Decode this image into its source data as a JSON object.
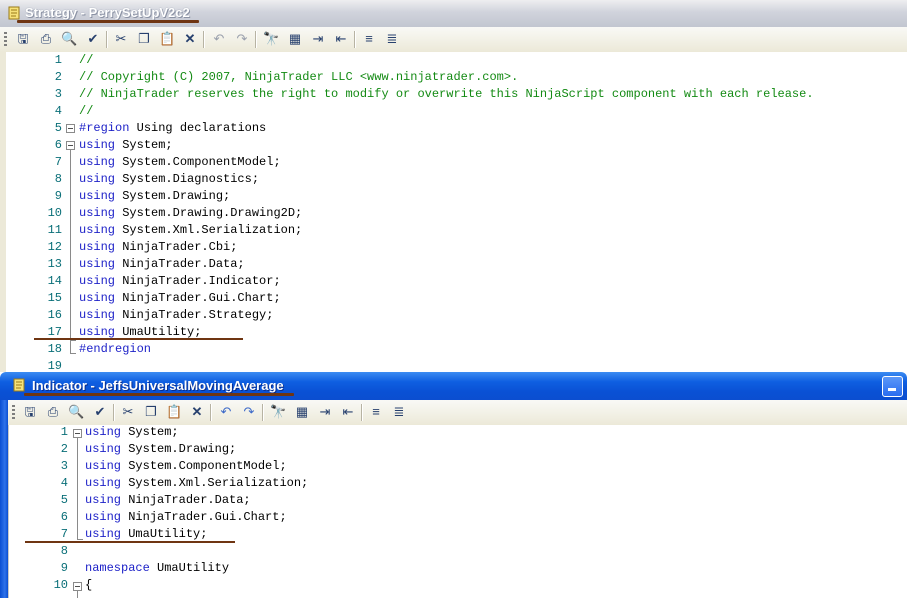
{
  "windows": {
    "strategy": {
      "title": "Strategy - PerrySetUpV2c2",
      "lines": [
        {
          "n": "1",
          "parts": [
            {
              "t": "//",
              "c": "cm"
            }
          ]
        },
        {
          "n": "2",
          "parts": [
            {
              "t": "// Copyright (C) 2007, NinjaTrader LLC <www.ninjatrader.com>.",
              "c": "cm"
            }
          ]
        },
        {
          "n": "3",
          "parts": [
            {
              "t": "// NinjaTrader reserves the right to modify or overwrite this NinjaScript component with each release.",
              "c": "cm"
            }
          ]
        },
        {
          "n": "4",
          "parts": [
            {
              "t": "//",
              "c": "cm"
            }
          ]
        },
        {
          "n": "5",
          "parts": [
            {
              "t": "#region",
              "c": "kw"
            },
            {
              "t": " Using declarations",
              "c": ""
            }
          ]
        },
        {
          "n": "6",
          "parts": [
            {
              "t": "using",
              "c": "kw"
            },
            {
              "t": " System;",
              "c": ""
            }
          ]
        },
        {
          "n": "7",
          "parts": [
            {
              "t": "using",
              "c": "kw"
            },
            {
              "t": " System.ComponentModel;",
              "c": ""
            }
          ]
        },
        {
          "n": "8",
          "parts": [
            {
              "t": "using",
              "c": "kw"
            },
            {
              "t": " System.Diagnostics;",
              "c": ""
            }
          ]
        },
        {
          "n": "9",
          "parts": [
            {
              "t": "using",
              "c": "kw"
            },
            {
              "t": " System.Drawing;",
              "c": ""
            }
          ]
        },
        {
          "n": "10",
          "parts": [
            {
              "t": "using",
              "c": "kw"
            },
            {
              "t": " System.Drawing.Drawing2D;",
              "c": ""
            }
          ]
        },
        {
          "n": "11",
          "parts": [
            {
              "t": "using",
              "c": "kw"
            },
            {
              "t": " System.Xml.Serialization;",
              "c": ""
            }
          ]
        },
        {
          "n": "12",
          "parts": [
            {
              "t": "using",
              "c": "kw"
            },
            {
              "t": " NinjaTrader.Cbi;",
              "c": ""
            }
          ]
        },
        {
          "n": "13",
          "parts": [
            {
              "t": "using",
              "c": "kw"
            },
            {
              "t": " NinjaTrader.Data;",
              "c": ""
            }
          ]
        },
        {
          "n": "14",
          "parts": [
            {
              "t": "using",
              "c": "kw"
            },
            {
              "t": " NinjaTrader.Indicator;",
              "c": ""
            }
          ]
        },
        {
          "n": "15",
          "parts": [
            {
              "t": "using",
              "c": "kw"
            },
            {
              "t": " NinjaTrader.Gui.Chart;",
              "c": ""
            }
          ]
        },
        {
          "n": "16",
          "parts": [
            {
              "t": "using",
              "c": "kw"
            },
            {
              "t": " NinjaTrader.Strategy;",
              "c": ""
            }
          ]
        },
        {
          "n": "17",
          "parts": [
            {
              "t": "using",
              "c": "kw"
            },
            {
              "t": " UmaUtility;",
              "c": ""
            }
          ]
        },
        {
          "n": "18",
          "parts": [
            {
              "t": "#endregion",
              "c": "kw"
            }
          ]
        },
        {
          "n": "19",
          "parts": []
        }
      ]
    },
    "indicator": {
      "title": "Indicator - JeffsUniversalMovingAverage",
      "lines": [
        {
          "n": "1",
          "parts": [
            {
              "t": "using",
              "c": "kw"
            },
            {
              "t": " System;",
              "c": ""
            }
          ]
        },
        {
          "n": "2",
          "parts": [
            {
              "t": "using",
              "c": "kw"
            },
            {
              "t": " System.Drawing;",
              "c": ""
            }
          ]
        },
        {
          "n": "3",
          "parts": [
            {
              "t": "using",
              "c": "kw"
            },
            {
              "t": " System.ComponentModel;",
              "c": ""
            }
          ]
        },
        {
          "n": "4",
          "parts": [
            {
              "t": "using",
              "c": "kw"
            },
            {
              "t": " System.Xml.Serialization;",
              "c": ""
            }
          ]
        },
        {
          "n": "5",
          "parts": [
            {
              "t": "using",
              "c": "kw"
            },
            {
              "t": " NinjaTrader.Data;",
              "c": ""
            }
          ]
        },
        {
          "n": "6",
          "parts": [
            {
              "t": "using",
              "c": "kw"
            },
            {
              "t": " NinjaTrader.Gui.Chart;",
              "c": ""
            }
          ]
        },
        {
          "n": "7",
          "parts": [
            {
              "t": "using",
              "c": "kw"
            },
            {
              "t": " UmaUtility;",
              "c": ""
            }
          ]
        },
        {
          "n": "8",
          "parts": []
        },
        {
          "n": "9",
          "parts": [
            {
              "t": "namespace",
              "c": "kw"
            },
            {
              "t": " UmaUtility",
              "c": ""
            }
          ]
        },
        {
          "n": "10",
          "parts": [
            {
              "t": "{",
              "c": ""
            }
          ]
        }
      ]
    }
  },
  "toolbar_icons": [
    "save-icon",
    "print-icon",
    "print-preview-icon",
    "compile-icon",
    "cut-icon",
    "copy-icon",
    "paste-icon",
    "delete-icon",
    "undo-icon",
    "redo-icon",
    "find-icon",
    "replace-icon",
    "indent-icon",
    "outdent-icon",
    "comment-icon",
    "uncomment-icon"
  ],
  "colors": {
    "keyword": "#1e22c8",
    "comment": "#138a13",
    "line_number": "#0a6f78",
    "annotation": "#6f3512"
  }
}
